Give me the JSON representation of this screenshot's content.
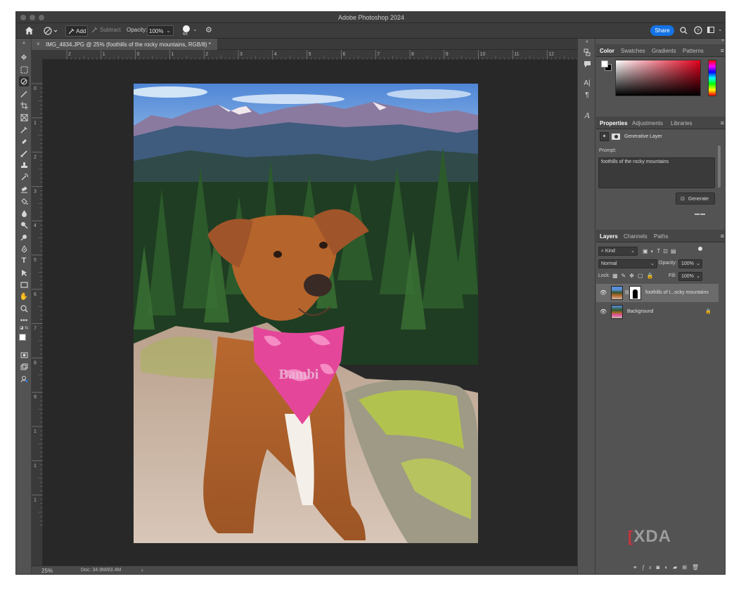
{
  "window": {
    "title": "Adobe Photoshop 2024"
  },
  "options": {
    "add_label": "Add",
    "subtract_label": "Subtract",
    "opacity_label": "Opacity:",
    "opacity_value": "100%",
    "brush_size": "68",
    "share_label": "Share"
  },
  "document": {
    "tab_label": "IMG_4834.JPG @ 25% (foothills of the rocky mountains, RGB/8) *",
    "zoom": "25%",
    "doc_size": "Doc: 34.9M/83.4M",
    "bandana_text": "Bambi"
  },
  "ruler": {
    "h_ticks": [
      "2",
      "1",
      "0",
      "1",
      "2",
      "3",
      "4",
      "5",
      "6",
      "7",
      "8",
      "9",
      "10",
      "11",
      "12"
    ],
    "v_ticks": [
      "0",
      "1",
      "2",
      "3",
      "4",
      "5",
      "6",
      "7",
      "8",
      "9",
      "1",
      "1",
      "1"
    ]
  },
  "color_panel": {
    "tabs": [
      "Color",
      "Swatches",
      "Gradients",
      "Patterns"
    ]
  },
  "properties_panel": {
    "tabs": [
      "Properties",
      "Adjustments",
      "Libraries"
    ],
    "layer_type": "Generative Layer",
    "prompt_label": "Prompt:",
    "prompt_value": "foothills of the rocky mountains",
    "generate_label": "Generate"
  },
  "layers_panel": {
    "tabs": [
      "Layers",
      "Channels",
      "Paths"
    ],
    "filter_kind": "Kind",
    "blend_mode": "Normal",
    "opacity_label": "Opacity:",
    "opacity_value": "100%",
    "lock_label": "Lock:",
    "fill_label": "Fill:",
    "fill_value": "100%",
    "layers": [
      {
        "name": "foothills of t...ocky mountains",
        "selected": true
      },
      {
        "name": "Background",
        "selected": false
      }
    ]
  },
  "watermark": "XDA",
  "colors": {
    "accent": "#1473e6",
    "panel": "#535353",
    "canvas": "#282828"
  }
}
